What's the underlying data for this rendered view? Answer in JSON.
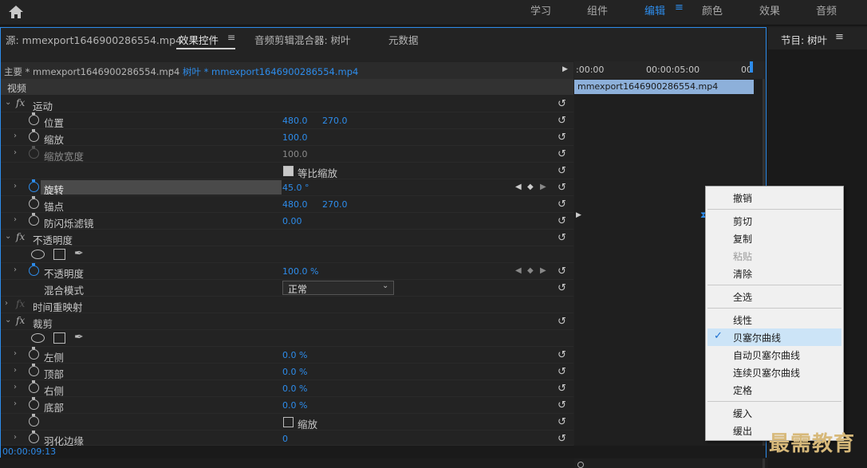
{
  "workspaces": {
    "learn": "学习",
    "assembly": "组件",
    "editing": "编辑",
    "color": "颜色",
    "effects": "效果",
    "audio": "音频"
  },
  "tabs": {
    "source": "源: mmexport1646900286554.mp4",
    "effect_controls": "效果控件",
    "audio_mixer": "音频剪辑混合器: 树叶",
    "metadata": "元数据"
  },
  "program_title": "节目: 树叶",
  "sequence": {
    "master": "主要 * mmexport1646900286554.mp4",
    "clip": "树叶 * mmexport1646900286554.mp4"
  },
  "section_video": "视频",
  "timeline": {
    "t0": ":00:00",
    "t1": "00:00:05:00",
    "t2": "00",
    "clip_name": "mmexport1646900286554.mp4"
  },
  "props": {
    "motion": "运动",
    "position": {
      "label": "位置",
      "v1": "480.0",
      "v2": "270.0"
    },
    "scale": {
      "label": "缩放",
      "v1": "100.0"
    },
    "scale_width": {
      "label": "缩放宽度",
      "v1": "100.0"
    },
    "uniform_scale": "等比缩放",
    "rotation": {
      "label": "旋转",
      "v1": "45.0 °"
    },
    "anchor": {
      "label": "锚点",
      "v1": "480.0",
      "v2": "270.0"
    },
    "antiflicker": {
      "label": "防闪烁滤镜",
      "v1": "0.00"
    },
    "opacity_group": "不透明度",
    "opacity": {
      "label": "不透明度",
      "v1": "100.0 %"
    },
    "blend": {
      "label": "混合模式",
      "value": "正常"
    },
    "time_remap": "时间重映射",
    "crop": "裁剪",
    "left": {
      "label": "左侧",
      "v1": "0.0 %"
    },
    "top": {
      "label": "顶部",
      "v1": "0.0 %"
    },
    "right": {
      "label": "右侧",
      "v1": "0.0 %"
    },
    "bottom": {
      "label": "底部",
      "v1": "0.0 %"
    },
    "zoom": "缩放",
    "feather": {
      "label": "羽化边缘",
      "v1": "0"
    }
  },
  "timecode": "00:00:09:13",
  "context_menu": {
    "undo": "撤销",
    "cut": "剪切",
    "copy": "复制",
    "paste": "粘贴",
    "clear": "清除",
    "select_all": "全选",
    "linear": "线性",
    "bezier": "贝塞尔曲线",
    "auto_bezier": "自动贝塞尔曲线",
    "continuous_bezier": "连续贝塞尔曲线",
    "hold": "定格",
    "ease_in": "缓入",
    "ease_out": "缓出"
  },
  "watermark": "最需教育"
}
